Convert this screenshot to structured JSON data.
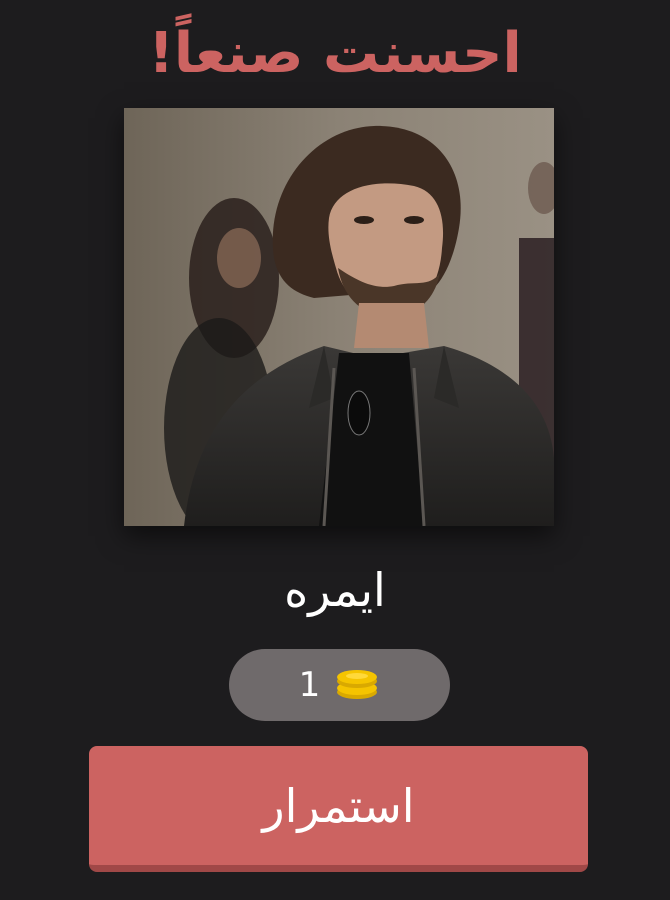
{
  "header": {
    "title": "!احسنت صنعاً"
  },
  "puzzle": {
    "image_icon": "portrait-photo",
    "answer": "ايمره"
  },
  "reward": {
    "coins": "1",
    "icon": "coin-stack-icon"
  },
  "actions": {
    "continue_label": "استمرار"
  },
  "colors": {
    "background": "#1d1c1e",
    "accent": "#cc6361",
    "pill": "#6f6a6b",
    "coin": "#f5c400"
  }
}
